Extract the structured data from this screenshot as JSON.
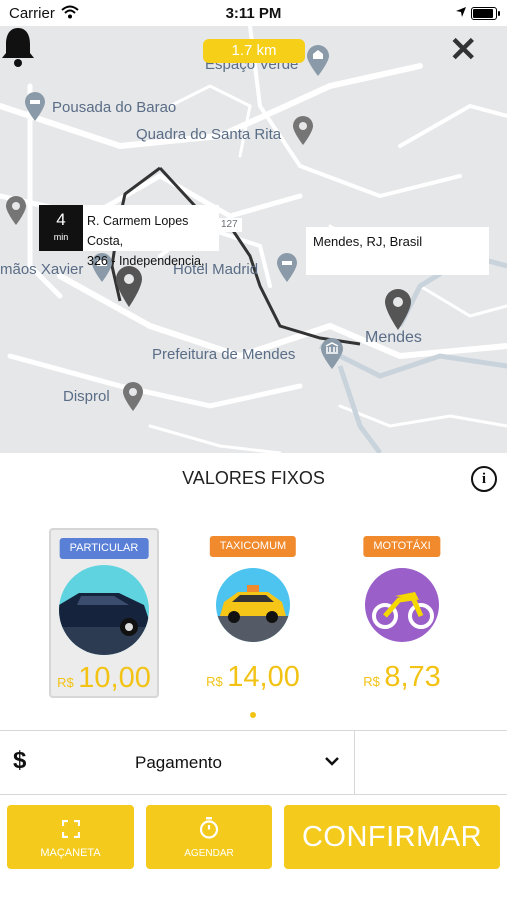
{
  "status_bar": {
    "carrier": "Carrier",
    "time": "3:11 PM"
  },
  "map": {
    "distance": "1.7 km",
    "eta": {
      "value": "4",
      "unit": "min"
    },
    "origin": {
      "line1": "R. Carmem Lopes Costa,",
      "line2": "326 - Independencia,"
    },
    "destination": "Mendes, RJ, Brasil",
    "road_number": "127",
    "places": {
      "espaco": "Espaço Verde",
      "pousada": "Pousada do Barao",
      "quadra": "Quadra do Santa Rita",
      "irmaos": "mãos Xavier",
      "hotel": "Hotel Madrid",
      "mendes": "Mendes",
      "prefeitura": "Prefeitura de Mendes",
      "disprol": "Disprol"
    }
  },
  "section": {
    "title": "VALORES FIXOS"
  },
  "options": [
    {
      "tag": "PARTICULAR",
      "tag_color": "#5a7fd6",
      "currency": "R$",
      "price": "10,00",
      "selected": true
    },
    {
      "tag": "TAXICOMUM",
      "tag_color": "#f08a2c",
      "currency": "R$",
      "price": "14,00",
      "selected": false
    },
    {
      "tag": "MOTOTÁXI",
      "tag_color": "#f08a2c",
      "currency": "R$",
      "price": "8,73",
      "selected": false
    }
  ],
  "payment": {
    "symbol": "$",
    "label": "Pagamento"
  },
  "actions": {
    "macaneta": "MAÇANETA",
    "agendar": "AGENDAR",
    "confirmar": "CONFIRMAR"
  },
  "colors": {
    "accent": "#f4cb1c",
    "price": "#f2c314"
  }
}
